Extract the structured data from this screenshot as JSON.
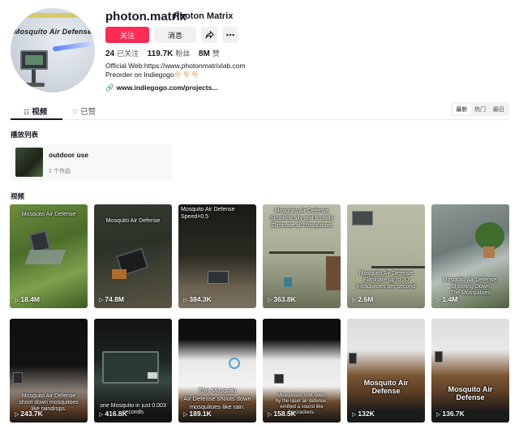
{
  "profile": {
    "username": "photon.matrix",
    "nickname": "Photon Matrix",
    "avatar_text": "Mosquito Air Defense",
    "follow_label": "关注",
    "message_label": "消息",
    "stats": {
      "following": "24",
      "following_label": "已关注",
      "followers": "119.7K",
      "followers_label": "粉丝",
      "likes": "8M",
      "likes_label": "赞"
    },
    "bio_line1": "Official Web:https://www.photonmatrixlab.com",
    "bio_line2": "Preorder on Indiegogo👇🏻👇🏻👇🏻",
    "link": "www.indiegogo.com/projects..."
  },
  "tabs": {
    "videos": "视频",
    "liked": "已赞"
  },
  "sort": [
    "最新",
    "热门",
    "最旧"
  ],
  "playlist_section": "播放列表",
  "playlist": {
    "title": "outdoor use",
    "count": "1 个作品"
  },
  "videos_section": "视频",
  "videos": [
    {
      "top": "Mosquito Air Defense",
      "bottom": "",
      "views": "18.4M"
    },
    {
      "top": "Mosquito Air Defense",
      "bottom": "",
      "views": "74.8M"
    },
    {
      "top": "Mosquito Air Defense\nSpeed×0.5",
      "bottom": "",
      "views": "384.3K"
    },
    {
      "top": "Mosquito Air Defense\nSimplistically and brutally\nEliminate all Mosquitoes",
      "bottom": "",
      "views": "363.8K"
    },
    {
      "top": "",
      "bottom": "Mosquito Air Defense\nEliminate up to 30\nmosquitoes per second",
      "views": "2.6M"
    },
    {
      "top": "",
      "bottom": "Mosquito Air Defense,\nShooting Down\nThe Mosquitoes",
      "views": "1.4M"
    },
    {
      "top": "",
      "bottom": "Mosquito Air Defense\nshoot down mosquitoes\nlike raindrops.",
      "views": "243.7K"
    },
    {
      "top": "",
      "bottom": "one Mosquito in just 0.003 seconds",
      "views": "416.8K"
    },
    {
      "top": "",
      "bottom": "This Mosquito\nAir Defense shoots down\nmosquitoes like rain.",
      "views": "189.1K"
    },
    {
      "top": "",
      "bottom": "Mosquitoes shot down\nby the laser air defense,\nemitted a sound like\nfirecrackers.",
      "views": "158.5K"
    },
    {
      "top": "",
      "bottom": "Mosquito Air Defense",
      "views": "132K"
    },
    {
      "top": "",
      "bottom": "Mosquito Air Defense",
      "views": "136.7K"
    }
  ]
}
